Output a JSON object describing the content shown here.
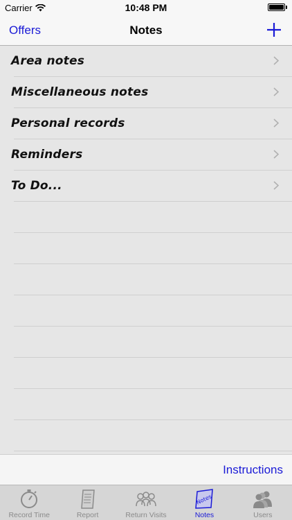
{
  "status_bar": {
    "carrier": "Carrier",
    "time": "10:48 PM"
  },
  "nav": {
    "left_label": "Offers",
    "title": "Notes",
    "add_icon": "plus-icon"
  },
  "list": {
    "items": [
      {
        "label": "Area notes"
      },
      {
        "label": "Miscellaneous notes"
      },
      {
        "label": "Personal records"
      },
      {
        "label": "Reminders"
      },
      {
        "label": "To Do..."
      }
    ]
  },
  "toolbar": {
    "instructions_label": "Instructions"
  },
  "tabbar": {
    "tabs": [
      {
        "label": "Record Time",
        "icon": "stopwatch-icon",
        "active": false
      },
      {
        "label": "Report",
        "icon": "report-icon",
        "active": false
      },
      {
        "label": "Return Visits",
        "icon": "return-visits-icon",
        "active": false
      },
      {
        "label": "Notes",
        "icon": "notes-icon",
        "active": true
      },
      {
        "label": "Users",
        "icon": "users-icon",
        "active": false
      }
    ]
  },
  "colors": {
    "accent": "#1a1ad6",
    "background": "#e6e6e6",
    "inactive_tab": "#8a8a8a"
  }
}
